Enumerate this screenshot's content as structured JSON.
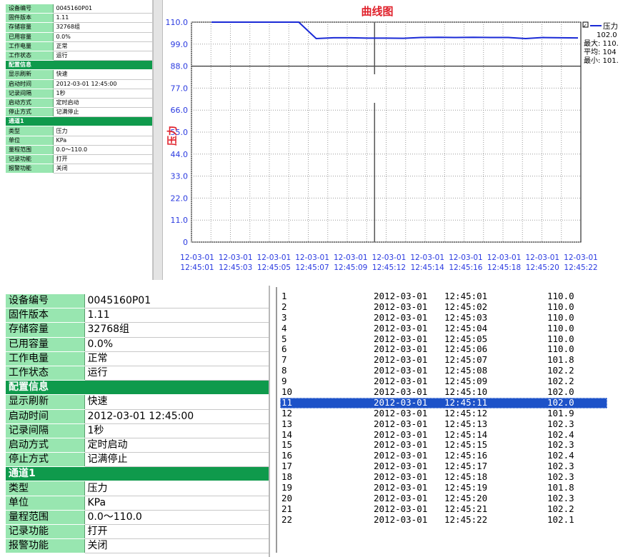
{
  "chart": {
    "title": "曲线图",
    "ylabel": "压力",
    "legend": {
      "series_name": "压力",
      "current": "102.0",
      "max": "最大: 110.",
      "avg": "平均: 104",
      "min": "最小: 101."
    }
  },
  "chart_data": {
    "type": "line",
    "title": "曲线图",
    "xlabel": "",
    "ylabel": "压力",
    "ylim": [
      0,
      110
    ],
    "yticks": [
      "0",
      "11.0",
      "22.0",
      "33.0",
      "44.0",
      "55.0",
      "66.0",
      "77.0",
      "88.0",
      "99.0",
      "110.0"
    ],
    "x": [
      "12:45:01",
      "12:45:02",
      "12:45:03",
      "12:45:04",
      "12:45:05",
      "12:45:06",
      "12:45:07",
      "12:45:08",
      "12:45:09",
      "12:45:10",
      "12:45:11",
      "12:45:12",
      "12:45:13",
      "12:45:14",
      "12:45:15",
      "12:45:16",
      "12:45:17",
      "12:45:18",
      "12:45:19",
      "12:45:20",
      "12:45:21",
      "12:45:22"
    ],
    "xticks": [
      {
        "date": "12-03-01",
        "time": "12:45:01"
      },
      {
        "date": "12-03-01",
        "time": "12:45:03"
      },
      {
        "date": "12-03-01",
        "time": "12:45:05"
      },
      {
        "date": "12-03-01",
        "time": "12:45:07"
      },
      {
        "date": "12-03-01",
        "time": "12:45:09"
      },
      {
        "date": "12-03-01",
        "time": "12:45:12"
      },
      {
        "date": "12-03-01",
        "time": "12:45:14"
      },
      {
        "date": "12-03-01",
        "time": "12:45:16"
      },
      {
        "date": "12-03-01",
        "time": "12:45:18"
      },
      {
        "date": "12-03-01",
        "time": "12:45:20"
      },
      {
        "date": "12-03-01",
        "time": "12:45:22"
      }
    ],
    "series": [
      {
        "name": "压力",
        "color": "#1a2ad6",
        "values": [
          110.0,
          110.0,
          110.0,
          110.0,
          110.0,
          110.0,
          101.8,
          102.2,
          102.2,
          102.0,
          102.0,
          101.9,
          102.3,
          102.4,
          102.3,
          102.4,
          102.3,
          102.3,
          101.8,
          102.3,
          102.2,
          102.1
        ]
      }
    ],
    "reference_line": 88.0,
    "cursor_x": "12:45:11",
    "grid": true,
    "legend": "top-right"
  },
  "props_small": [
    {
      "k": "设备编号",
      "v": "0045160P01"
    },
    {
      "k": "固件版本",
      "v": "1.11"
    },
    {
      "k": "存储容量",
      "v": "32768组"
    },
    {
      "k": "已用容量",
      "v": "0.0%"
    },
    {
      "k": "工作电量",
      "v": "正常"
    },
    {
      "k": "工作状态",
      "v": "运行"
    },
    {
      "section": "配置信息"
    },
    {
      "k": "显示刷新",
      "v": "快速"
    },
    {
      "k": "启动时间",
      "v": "2012-03-01 12:45:00"
    },
    {
      "k": "记录间隔",
      "v": "1秒"
    },
    {
      "k": "启动方式",
      "v": "定时启动"
    },
    {
      "k": "停止方式",
      "v": "记满停止"
    },
    {
      "section": "通道1"
    },
    {
      "k": "类型",
      "v": "压力"
    },
    {
      "k": "单位",
      "v": "KPa"
    },
    {
      "k": "量程范围",
      "v": "0.0～110.0"
    },
    {
      "k": "记录功能",
      "v": "打开"
    },
    {
      "k": "报警功能",
      "v": "关闭"
    }
  ],
  "props_large": [
    {
      "k": "设备编号",
      "v": "0045160P01"
    },
    {
      "k": "固件版本",
      "v": "1.11"
    },
    {
      "k": "存储容量",
      "v": "32768组"
    },
    {
      "k": "已用容量",
      "v": "0.0%"
    },
    {
      "k": "工作电量",
      "v": "正常"
    },
    {
      "k": "工作状态",
      "v": "运行"
    },
    {
      "section": "配置信息"
    },
    {
      "k": "显示刷新",
      "v": "快速"
    },
    {
      "k": "启动时间",
      "v": "2012-03-01 12:45:00"
    },
    {
      "k": "记录间隔",
      "v": "1秒"
    },
    {
      "k": "启动方式",
      "v": "定时启动"
    },
    {
      "k": "停止方式",
      "v": "记满停止"
    },
    {
      "section": "通道1"
    },
    {
      "k": "类型",
      "v": "压力"
    },
    {
      "k": "单位",
      "v": "KPa"
    },
    {
      "k": "量程范围",
      "v": "0.0～110.0"
    },
    {
      "k": "记录功能",
      "v": "打开"
    },
    {
      "k": "报警功能",
      "v": "关闭"
    }
  ],
  "records": [
    {
      "idx": "1",
      "date": "2012-03-01",
      "time": "12:45:01",
      "value": "110.0"
    },
    {
      "idx": "2",
      "date": "2012-03-01",
      "time": "12:45:02",
      "value": "110.0"
    },
    {
      "idx": "3",
      "date": "2012-03-01",
      "time": "12:45:03",
      "value": "110.0"
    },
    {
      "idx": "4",
      "date": "2012-03-01",
      "time": "12:45:04",
      "value": "110.0"
    },
    {
      "idx": "5",
      "date": "2012-03-01",
      "time": "12:45:05",
      "value": "110.0"
    },
    {
      "idx": "6",
      "date": "2012-03-01",
      "time": "12:45:06",
      "value": "110.0"
    },
    {
      "idx": "7",
      "date": "2012-03-01",
      "time": "12:45:07",
      "value": "101.8"
    },
    {
      "idx": "8",
      "date": "2012-03-01",
      "time": "12:45:08",
      "value": "102.2"
    },
    {
      "idx": "9",
      "date": "2012-03-01",
      "time": "12:45:09",
      "value": "102.2"
    },
    {
      "idx": "10",
      "date": "2012-03-01",
      "time": "12:45:10",
      "value": "102.0"
    },
    {
      "idx": "11",
      "date": "2012-03-01",
      "time": "12:45:11",
      "value": "102.0",
      "selected": true
    },
    {
      "idx": "12",
      "date": "2012-03-01",
      "time": "12:45:12",
      "value": "101.9"
    },
    {
      "idx": "13",
      "date": "2012-03-01",
      "time": "12:45:13",
      "value": "102.3"
    },
    {
      "idx": "14",
      "date": "2012-03-01",
      "time": "12:45:14",
      "value": "102.4"
    },
    {
      "idx": "15",
      "date": "2012-03-01",
      "time": "12:45:15",
      "value": "102.3"
    },
    {
      "idx": "16",
      "date": "2012-03-01",
      "time": "12:45:16",
      "value": "102.4"
    },
    {
      "idx": "17",
      "date": "2012-03-01",
      "time": "12:45:17",
      "value": "102.3"
    },
    {
      "idx": "18",
      "date": "2012-03-01",
      "time": "12:45:18",
      "value": "102.3"
    },
    {
      "idx": "19",
      "date": "2012-03-01",
      "time": "12:45:19",
      "value": "101.8"
    },
    {
      "idx": "20",
      "date": "2012-03-01",
      "time": "12:45:20",
      "value": "102.3"
    },
    {
      "idx": "21",
      "date": "2012-03-01",
      "time": "12:45:21",
      "value": "102.2"
    },
    {
      "idx": "22",
      "date": "2012-03-01",
      "time": "12:45:22",
      "value": "102.1"
    }
  ],
  "colors": {
    "accent": "#0f9a4c",
    "key_bg": "#98e6b0",
    "line": "#1a2ad6",
    "axis_text": "#2a3ae0",
    "title": "#e0202a",
    "selection": "#1d52c8"
  }
}
